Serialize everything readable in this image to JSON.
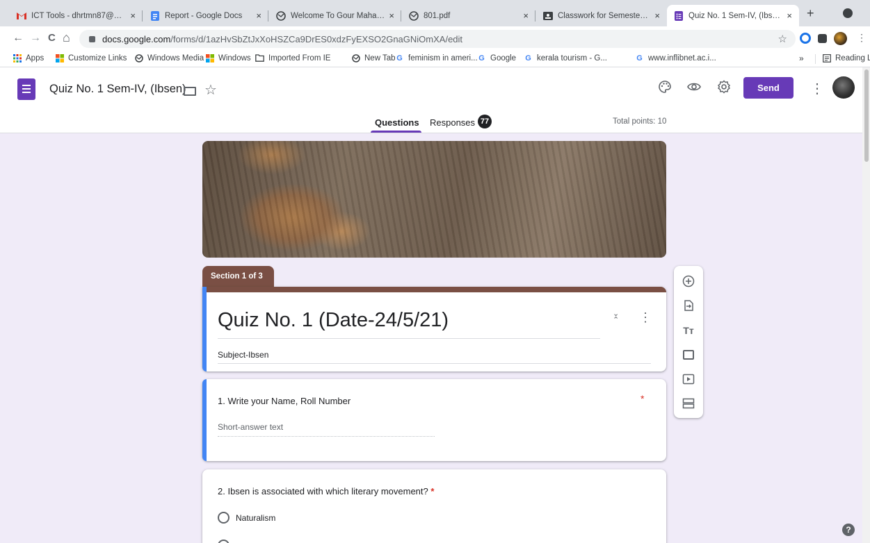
{
  "browser": {
    "tabs": [
      {
        "title": "ICT Tools - dhrtmn87@gma",
        "icon": "gmail-icon",
        "color": "#d93025"
      },
      {
        "title": "Report - Google Docs",
        "icon": "docs-icon",
        "color": "#4285f4"
      },
      {
        "title": "Welcome To Gour Mahavid",
        "icon": "globe-icon",
        "color": "#3c4043"
      },
      {
        "title": "801.pdf",
        "icon": "globe-icon",
        "color": "#3c4043"
      },
      {
        "title": "Classwork for Semester-IV",
        "icon": "classroom-icon",
        "color": "#3c4043"
      },
      {
        "title": "Quiz No. 1 Sem-IV, (Ibsen)",
        "icon": "forms-icon",
        "color": "#673ab7"
      }
    ],
    "tab_close": "×",
    "new_tab": "+",
    "url_host": "docs.google.com",
    "url_path": "/forms/d/1azHvSbZtJxXoHSZCa9DrES0xdzFyEXSO2GnaGNiOmXA/edit",
    "nav": {
      "back": "←",
      "forward": "→",
      "reload": "C",
      "home": "⌂",
      "star": "☆",
      "more": "⋮"
    },
    "bookmarks": [
      {
        "label": "Apps",
        "icon": "apps-grid-icon"
      },
      {
        "label": "Customize Links",
        "icon": "windows-icon"
      },
      {
        "label": "Windows Media",
        "icon": "globe-icon"
      },
      {
        "label": "Windows",
        "icon": "windows-icon"
      },
      {
        "label": "Imported From IE",
        "icon": "folder-icon"
      },
      {
        "label": "New Tab",
        "icon": "globe-icon"
      },
      {
        "label": "feminism in ameri...",
        "icon": "google-icon"
      },
      {
        "label": "Google",
        "icon": "google-icon"
      },
      {
        "label": "kerala tourism - G...",
        "icon": "google-icon"
      },
      {
        "label": "www.inflibnet.ac.i...",
        "icon": "google-icon"
      }
    ],
    "bookmarks_overflow": "»",
    "reading_list": "Reading List"
  },
  "forms_header": {
    "doc_title": "Quiz No. 1 Sem-IV, (Ibsen)",
    "send_label": "Send",
    "tabs": {
      "questions": "Questions",
      "responses": "Responses"
    },
    "responses_count": "77",
    "total_points": "Total points: 10"
  },
  "form": {
    "section_label": "Section 1 of 3",
    "title": "Quiz No. 1 (Date-24/5/21)",
    "description": "Subject-Ibsen",
    "questions": [
      {
        "text": "1. Write your Name, Roll Number",
        "required_mark": "*",
        "placeholder": "Short-answer text"
      },
      {
        "text": "2. Ibsen is associated with which literary movement?",
        "required_mark": "*",
        "options": [
          "Naturalism"
        ]
      }
    ]
  },
  "colors": {
    "accent": "#673ab7",
    "section": "#7a4f44",
    "focus": "#4285f4",
    "required": "#d93025"
  }
}
